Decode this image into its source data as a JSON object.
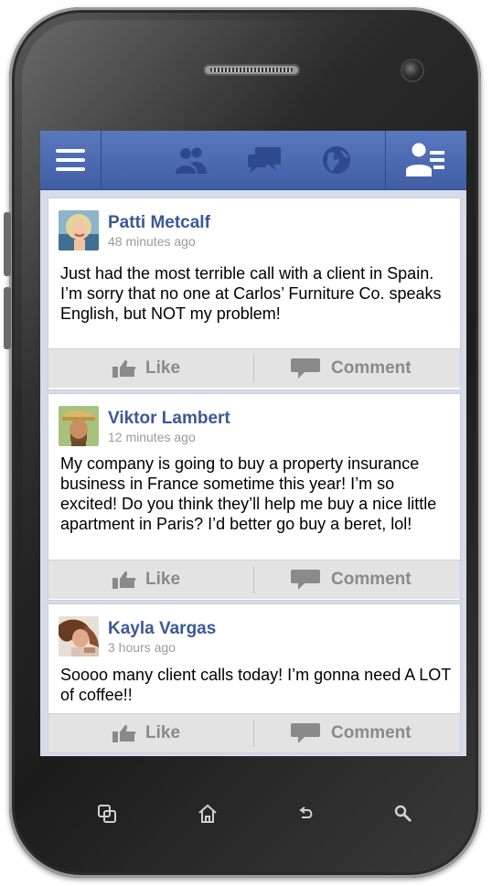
{
  "topbar": {
    "menu_icon": "hamburger-icon",
    "friends_icon": "friends-icon",
    "chat_icon": "chat-icon",
    "globe_icon": "globe-icon",
    "profile_icon": "profile-list-icon"
  },
  "posts": [
    {
      "author": "Patti Metcalf",
      "time": "48 minutes ago",
      "text": "Just had the most terrible call with a client in Spain. I’m sorry that no one at Carlos’ Furniture Co. speaks English, but NOT my problem!",
      "like_label": "Like",
      "comment_label": "Comment"
    },
    {
      "author": "Viktor Lambert",
      "time": "12 minutes ago",
      "text": "My company is going to buy a property insurance business in France sometime this year! I’m so excited! Do you think they’ll help me buy a nice little apartment in Paris? I’d better go buy a beret, lol!",
      "like_label": "Like",
      "comment_label": "Comment"
    },
    {
      "author": "Kayla Vargas",
      "time": "3 hours ago",
      "text": "Soooo many client calls today! I’m gonna need A LOT of coffee!!",
      "like_label": "Like",
      "comment_label": "Comment"
    }
  ],
  "android_nav": {
    "recent_icon": "recent-apps-icon",
    "home_icon": "home-icon",
    "back_icon": "back-icon",
    "search_icon": "search-icon"
  },
  "colors": {
    "topbar": "#4b69b0",
    "author": "#3b5998",
    "action_bar": "#e3e3e3"
  }
}
